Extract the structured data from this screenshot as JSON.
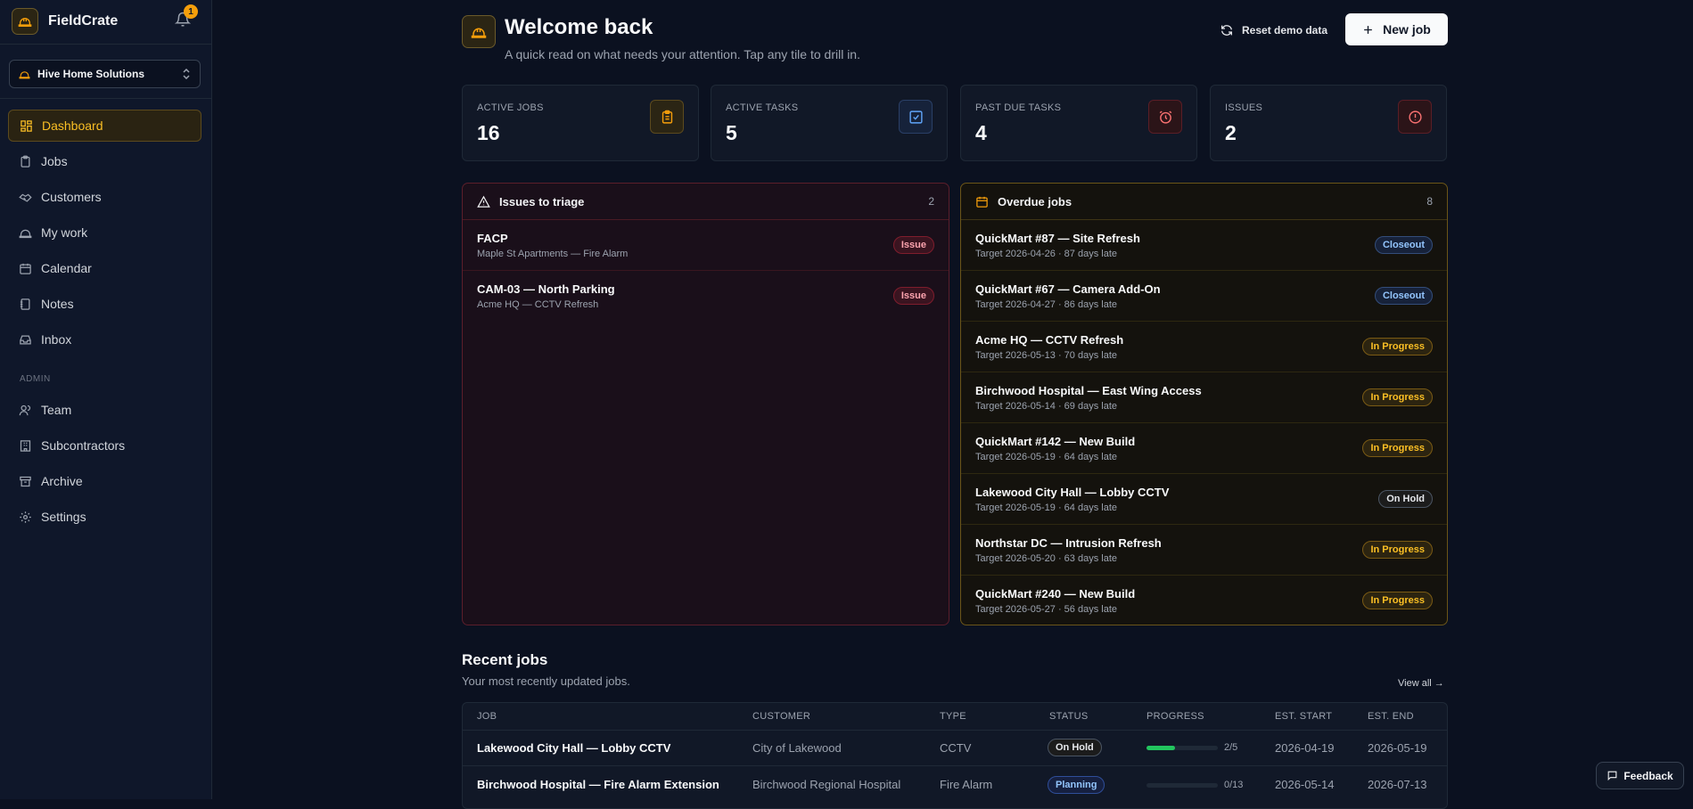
{
  "app": {
    "name": "FieldCrate",
    "notifications": "1",
    "accent": "#f59e0b"
  },
  "org": {
    "name": "Hive Home Solutions"
  },
  "nav": {
    "items": [
      {
        "label": "Dashboard",
        "icon": "dashboard-icon"
      },
      {
        "label": "Jobs",
        "icon": "clipboard-icon"
      },
      {
        "label": "Customers",
        "icon": "handshake-icon"
      },
      {
        "label": "My work",
        "icon": "hardhat-icon"
      },
      {
        "label": "Calendar",
        "icon": "calendar-icon"
      },
      {
        "label": "Notes",
        "icon": "notebook-icon"
      },
      {
        "label": "Inbox",
        "icon": "inbox-icon"
      }
    ],
    "admin_label": "ADMIN",
    "admin_items": [
      {
        "label": "Team",
        "icon": "users-icon"
      },
      {
        "label": "Subcontractors",
        "icon": "building-icon"
      },
      {
        "label": "Archive",
        "icon": "archive-icon"
      },
      {
        "label": "Settings",
        "icon": "gear-icon"
      }
    ]
  },
  "header": {
    "title": "Welcome back",
    "subtitle": "A quick read on what needs your attention. Tap any tile to drill in.",
    "reset_label": "Reset demo data",
    "new_job_label": "New job"
  },
  "kpis": [
    {
      "label": "ACTIVE JOBS",
      "value": "16",
      "icon": "clipboard-icon",
      "color": "#f59e0b"
    },
    {
      "label": "ACTIVE TASKS",
      "value": "5",
      "icon": "check-square-icon",
      "color": "#60a5fa"
    },
    {
      "label": "PAST DUE TASKS",
      "value": "4",
      "icon": "alarm-icon",
      "color": "#f87171"
    },
    {
      "label": "ISSUES",
      "value": "2",
      "icon": "alert-circle-icon",
      "color": "#f87171"
    }
  ],
  "issues": {
    "title": "Issues to triage",
    "count": "2",
    "items": [
      {
        "title": "FACP",
        "sub": "Maple St Apartments — Fire Alarm",
        "badge": "Issue"
      },
      {
        "title": "CAM-03 — North Parking",
        "sub": "Acme HQ — CCTV Refresh",
        "badge": "Issue"
      }
    ]
  },
  "overdue": {
    "title": "Overdue jobs",
    "count": "8",
    "items": [
      {
        "title": "QuickMart #87 — Site Refresh",
        "sub": "Target 2026-04-26 · 87 days late",
        "badge": "Closeout"
      },
      {
        "title": "QuickMart #67 — Camera Add-On",
        "sub": "Target 2026-04-27 · 86 days late",
        "badge": "Closeout"
      },
      {
        "title": "Acme HQ — CCTV Refresh",
        "sub": "Target 2026-05-13 · 70 days late",
        "badge": "In Progress"
      },
      {
        "title": "Birchwood Hospital — East Wing Access",
        "sub": "Target 2026-05-14 · 69 days late",
        "badge": "In Progress"
      },
      {
        "title": "QuickMart #142 — New Build",
        "sub": "Target 2026-05-19 · 64 days late",
        "badge": "In Progress"
      },
      {
        "title": "Lakewood City Hall — Lobby CCTV",
        "sub": "Target 2026-05-19 · 64 days late",
        "badge": "On Hold"
      },
      {
        "title": "Northstar DC — Intrusion Refresh",
        "sub": "Target 2026-05-20 · 63 days late",
        "badge": "In Progress"
      },
      {
        "title": "QuickMart #240 — New Build",
        "sub": "Target 2026-05-27 · 56 days late",
        "badge": "In Progress"
      }
    ]
  },
  "recent": {
    "title": "Recent jobs",
    "subtitle": "Your most recently updated jobs.",
    "view_all": "View all →",
    "columns": [
      "JOB",
      "CUSTOMER",
      "TYPE",
      "STATUS",
      "PROGRESS",
      "EST. START",
      "EST. END"
    ],
    "rows": [
      {
        "job": "Lakewood City Hall — Lobby CCTV",
        "customer": "City of Lakewood",
        "type": "CCTV",
        "status": "On Hold",
        "progress": "2/5",
        "progress_fraction": 0.4,
        "start": "2026-04-19",
        "end": "2026-05-19"
      },
      {
        "job": "Birchwood Hospital — Fire Alarm Extension",
        "customer": "Birchwood Regional Hospital",
        "type": "Fire Alarm",
        "status": "Planning",
        "progress": "0/13",
        "progress_fraction": 0,
        "start": "2026-05-14",
        "end": "2026-07-13"
      }
    ]
  },
  "feedback": {
    "label": "Feedback"
  }
}
